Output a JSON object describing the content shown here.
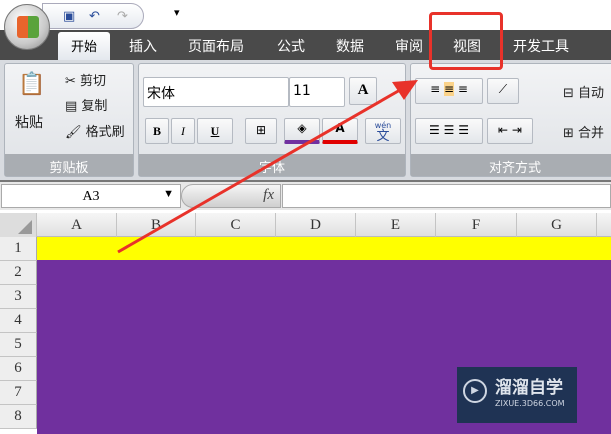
{
  "quick_access": {
    "save_icon": "save-icon",
    "undo_icon": "undo-icon",
    "redo_icon": "redo-icon",
    "customize_icon": "customize-icon"
  },
  "tabs": [
    "开始",
    "插入",
    "页面布局",
    "公式",
    "数据",
    "审阅",
    "视图",
    "开发工具"
  ],
  "clipboard": {
    "paste": "粘贴",
    "cut": "剪切",
    "copy": "复制",
    "format_painter": "格式刷",
    "label": "剪贴板"
  },
  "font": {
    "name": "宋体",
    "size": "11",
    "grow": "A",
    "bold": "B",
    "italic": "I",
    "underline": "U",
    "phonetic": "文",
    "phonetic_top": "wén",
    "label": "字体",
    "fill_color": "#7030a0",
    "font_color": "#e00000"
  },
  "alignment": {
    "wrap": "自动",
    "merge": "合并",
    "label": "对齐方式"
  },
  "formula_bar": {
    "name_box": "A3",
    "fx": "fx",
    "value": ""
  },
  "columns": [
    "A",
    "B",
    "C",
    "D",
    "E",
    "F",
    "G"
  ],
  "rows": [
    "1",
    "2",
    "3",
    "4",
    "5",
    "6",
    "7",
    "8"
  ],
  "fills": {
    "row1": "#ffff00",
    "rows2_8": "#70309e"
  },
  "watermark": {
    "title": "溜溜自学",
    "url": "ZIXUE.3D66.COM"
  }
}
